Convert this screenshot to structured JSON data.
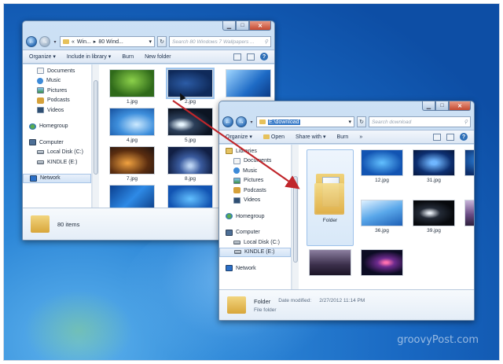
{
  "watermark": "groovyPost.com",
  "window1": {
    "title_controls": {
      "minimize": "▁",
      "maximize": "□",
      "close": "✕"
    },
    "address": {
      "crumbs": [
        "Win...",
        "80 Wind..."
      ],
      "search_placeholder": "Search 80 Windows 7 Wallpapers ..."
    },
    "toolbar": {
      "organize": "Organize ▾",
      "include": "Include in library ▾",
      "burn": "Burn",
      "new_folder": "New folder"
    },
    "nav": [
      {
        "label": "Documents",
        "icon": "documents-icon",
        "sub": true
      },
      {
        "label": "Music",
        "icon": "music-icon",
        "sub": true
      },
      {
        "label": "Pictures",
        "icon": "pictures-icon",
        "sub": true
      },
      {
        "label": "Podcasts",
        "icon": "podcasts-icon",
        "sub": true
      },
      {
        "label": "Videos",
        "icon": "videos-icon",
        "sub": true
      },
      {
        "label": "Homegroup",
        "icon": "homegroup-icon",
        "sub": false,
        "gap": true
      },
      {
        "label": "Computer",
        "icon": "computer-icon",
        "sub": false,
        "gap": true
      },
      {
        "label": "Local Disk (C:)",
        "icon": "disk-icon",
        "sub": true
      },
      {
        "label": "KINDLE (E:)",
        "icon": "disk-icon",
        "sub": true
      },
      {
        "label": "Network",
        "icon": "network-icon",
        "sub": false,
        "gap": true,
        "selected": true
      }
    ],
    "files": [
      {
        "name": "1.jpg",
        "style": "t-green"
      },
      {
        "name": "2.jpg",
        "style": "t-blue1",
        "hover": true
      },
      {
        "name": "",
        "style": "t-blue2"
      },
      {
        "name": "4.jpg",
        "style": "t-blue3"
      },
      {
        "name": "5.jpg",
        "style": "t-dark"
      },
      {
        "name": "",
        "style": "t-blue4"
      },
      {
        "name": "7.jpg",
        "style": "t-orange"
      },
      {
        "name": "8.jpg",
        "style": "t-navy"
      },
      {
        "name": "",
        "style": "t-blue5"
      },
      {
        "name": "",
        "style": "t-blue6"
      },
      {
        "name": "",
        "style": "t-win"
      },
      {
        "name": "",
        "style": "t-blue4"
      }
    ],
    "status": {
      "count": "80 items"
    }
  },
  "window2": {
    "title_controls": {
      "minimize": "▁",
      "maximize": "□",
      "close": "✕"
    },
    "address": {
      "path": "E:\\download",
      "search_placeholder": "Search download"
    },
    "toolbar": {
      "organize": "Organize ▾",
      "open": "Open",
      "share": "Share with ▾",
      "burn": "Burn",
      "more": "»"
    },
    "nav": [
      {
        "label": "Libraries",
        "icon": "libraries-icon",
        "sub": false
      },
      {
        "label": "Documents",
        "icon": "documents-icon",
        "sub": true
      },
      {
        "label": "Music",
        "icon": "music-icon",
        "sub": true
      },
      {
        "label": "Pictures",
        "icon": "pictures-icon",
        "sub": true
      },
      {
        "label": "Podcasts",
        "icon": "podcasts-icon",
        "sub": true
      },
      {
        "label": "Videos",
        "icon": "videos-icon",
        "sub": true
      },
      {
        "label": "Homegroup",
        "icon": "homegroup-icon",
        "sub": false,
        "gap": true
      },
      {
        "label": "Computer",
        "icon": "computer-icon",
        "sub": false,
        "gap": true
      },
      {
        "label": "Local Disk (C:)",
        "icon": "disk-icon",
        "sub": true
      },
      {
        "label": "KINDLE (E:)",
        "icon": "disk-icon",
        "sub": true,
        "selected": true
      },
      {
        "label": "Network",
        "icon": "network-icon",
        "sub": false,
        "gap": true
      }
    ],
    "folder_item": {
      "name": "Folder"
    },
    "files": [
      {
        "name": "12.jpg",
        "style": "t-win"
      },
      {
        "name": "31.jpg",
        "style": "t-deep"
      },
      {
        "name": "32.jpg",
        "style": "t-navy2"
      },
      {
        "name": "36.jpg",
        "style": "t-sky"
      },
      {
        "name": "39.jpg",
        "style": "t-black"
      },
      {
        "name": "",
        "style": "t-purple"
      },
      {
        "name": "",
        "style": "t-guitar"
      },
      {
        "name": "",
        "style": "t-space"
      }
    ],
    "details": {
      "name": "Folder",
      "type": "File folder",
      "modified_label": "Date modified:",
      "modified_value": "2/27/2012 11:14 PM"
    }
  }
}
